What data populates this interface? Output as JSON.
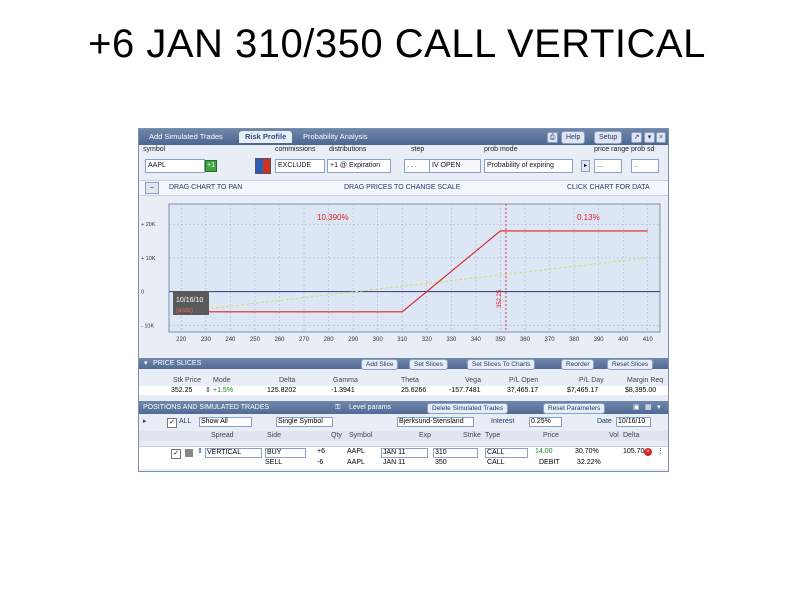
{
  "slide_title": "+6 JAN 310/350 CALL VERTICAL",
  "tabs": [
    "Add Simulated Trades",
    "Risk Profile",
    "Probability Analysis"
  ],
  "toolbar": {
    "help": "Help",
    "setup": "Setup"
  },
  "controls": {
    "labels": [
      "symbol",
      "commissions",
      "distributions",
      "step",
      "prob mode",
      "price range",
      "prob sd"
    ],
    "symbol": "AAPL",
    "commission": "EXCLUDE",
    "dist": "+1 @ Expiration",
    "step": ". . .",
    "prob_mode": "Probability of expiring",
    "price_range": "..."
  },
  "hints": {
    "left": "DRAG CHART TO PAN",
    "center": "DRAG PRICES TO CHANGE SCALE",
    "right": "CLICK CHART FOR DATA"
  },
  "chart_data": {
    "type": "line",
    "y_ticks": [
      "+ 20K",
      "+ 10K",
      "0",
      "- 10K"
    ],
    "x_ticks": [
      "220",
      "230",
      "240",
      "250",
      "260",
      "270",
      "280",
      "290",
      "300",
      "310",
      "320",
      "330",
      "340",
      "350",
      "360",
      "370",
      "380",
      "390",
      "400",
      "410"
    ],
    "annotations": {
      "prob_left": "10.390%",
      "prob_right": "0.13%",
      "vertical_marker": "352.25",
      "date_box": "10/16/10",
      "date_box_sub": "(ends)"
    },
    "series": [
      {
        "x": [
          220,
          310,
          350,
          410
        ],
        "y": [
          -6000,
          -6000,
          18000,
          18000
        ]
      },
      {
        "x": [
          220,
          410
        ],
        "y": [
          -6000,
          10000
        ]
      }
    ],
    "xlim": [
      215,
      415
    ],
    "ylim": [
      -12000,
      26000
    ]
  },
  "price_slices": {
    "title": "PRICE SLICES",
    "buttons": [
      "Add Slice",
      "Set Slices",
      "Set Slices To Charts",
      "Reorder",
      "Reset Slices"
    ],
    "headers": [
      "Stk Price",
      "Mode",
      "Delta",
      "Gamma",
      "Theta",
      "Vega",
      "P/L Open",
      "P/L Day",
      "Margin Req"
    ],
    "row": [
      "352.25",
      "+1.5%",
      "125.8202",
      "-1.3941",
      "25.6266",
      "-157.7481",
      "37,465.17",
      "$7,465.17",
      "$8,395.00"
    ]
  },
  "positions": {
    "title": "POSITIONS AND SIMULATED TRADES",
    "center": "Level params",
    "buttons": [
      "Delete Simulated Trades",
      "Reset Parameters"
    ],
    "filter": {
      "all": "ALL",
      "show": "Show All",
      "group": "Single Symbol",
      "model": "Bjerksund-Stensland",
      "interest_label": "Interest",
      "interest": "0.25%",
      "date_label": "Date",
      "date": "10/16/10"
    },
    "headers": [
      "Spread",
      "Side",
      "Qty",
      "Symbol",
      "Exp",
      "Strike",
      "Type",
      "Price",
      "Vol",
      "Delta"
    ],
    "rows": [
      [
        "VERTICAL",
        "BUY",
        "+6",
        "AAPL",
        "JAN 11",
        "310",
        "CALL",
        "14.00",
        "30.70%",
        "105.70"
      ],
      [
        "",
        "SELL",
        "-6",
        "AAPL",
        "JAN 11",
        "350",
        "CALL",
        "DEBIT",
        "32.22%",
        ""
      ]
    ]
  },
  "colors": {
    "header_blue": "#4d6690",
    "plot_bg": "#dce6f5",
    "pl_line": "#dd2222",
    "theo_line": "#d9d96a"
  }
}
